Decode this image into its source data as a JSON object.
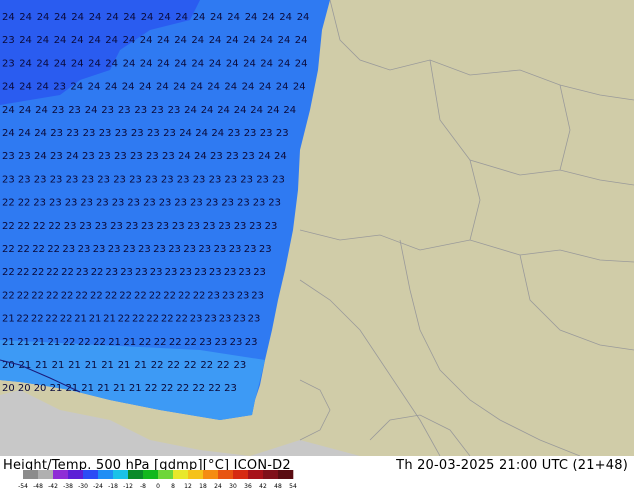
{
  "footer": {
    "title": "Height/Temp. 500 hPa [gdmp][°C] ICON-D2",
    "valid_time": "Th 20-03-2025 21:00 UTC (21+48)"
  },
  "colorbar": {
    "labels": [
      "-54",
      "-48",
      "-42",
      "-38",
      "-30",
      "-24",
      "-18",
      "-12",
      "-8",
      "0",
      "8",
      "12",
      "18",
      "24",
      "30",
      "36",
      "42",
      "48",
      "54"
    ],
    "colors": [
      "#8c8c8c",
      "#b0b0b0",
      "#8e2dd6",
      "#5c1fd6",
      "#2c4cf5",
      "#1f8ef5",
      "#19c2e8",
      "#0a8a2a",
      "#12b81e",
      "#6ed63a",
      "#e8e82a",
      "#f5c21a",
      "#f58c12",
      "#e85412",
      "#d62a12",
      "#a8121a",
      "#80101a",
      "#5a0c12"
    ]
  },
  "map": {
    "land_color": "#d0cca8",
    "sea_color": "#c8c8c8",
    "field_color": "#2f7af2",
    "field_dark_color": "#2a5cf0",
    "rows": [
      "24 24 24 24 24 24 24 24 24 24 24 24 24 24 24 24 24 24",
      "23 24 24 24 24 24 24 24 24 24 24 24 24 24 24 24 24 24",
      "23 24 24 24 24 24 24 24 24 24 24 24 24 24 24 24 24 24",
      "24 24 24 23 24 24 24 24 24 24 24 24 24 24 24 24 24 24",
      "24 24 24 23 23 24 23 23 23 23 23 24 24 24 24 24 24 24",
      "24 24 24 23 23 23 23 23 23 23 23 24 24 24 23 23 23 23",
      "23 23 24 23 24 23 23 23 23 23 23 24 24 23 23 23 24 24",
      "23 23 23 23 23 23 23 23 23 23 23 23 23 23 23 23 23 23",
      "22 22 23 23 23 23 23 23 23 23 23 23 23 23 23 23 23 23",
      "22 22 22 22 23 23 23 23 23 23 23 23 23 23 23 23 23 23",
      "22 22 22 22 23 23 23 23 23 23 23 23 23 23 23 23 23 23",
      "22 22 22 22 22 23 22 23 23 23 23 23 23 23 23 23 23 23",
      "22 22 22 22 22 22 22 22 22 22 22 22 22 22 23 23 23 23",
      "21 22 22 22 22 21 21 21 22 22 22 22 22 23 23 23 23 23",
      "21 21 21 21 22 22 22 21 21 22 22 22 22 23 23 23 23",
      "20 21 21 21 21 21 21 21 21 22 22 22 22 22 23",
      "20 20 20 21 21 21 21 21 21 22 22 22 22 22 23"
    ]
  }
}
